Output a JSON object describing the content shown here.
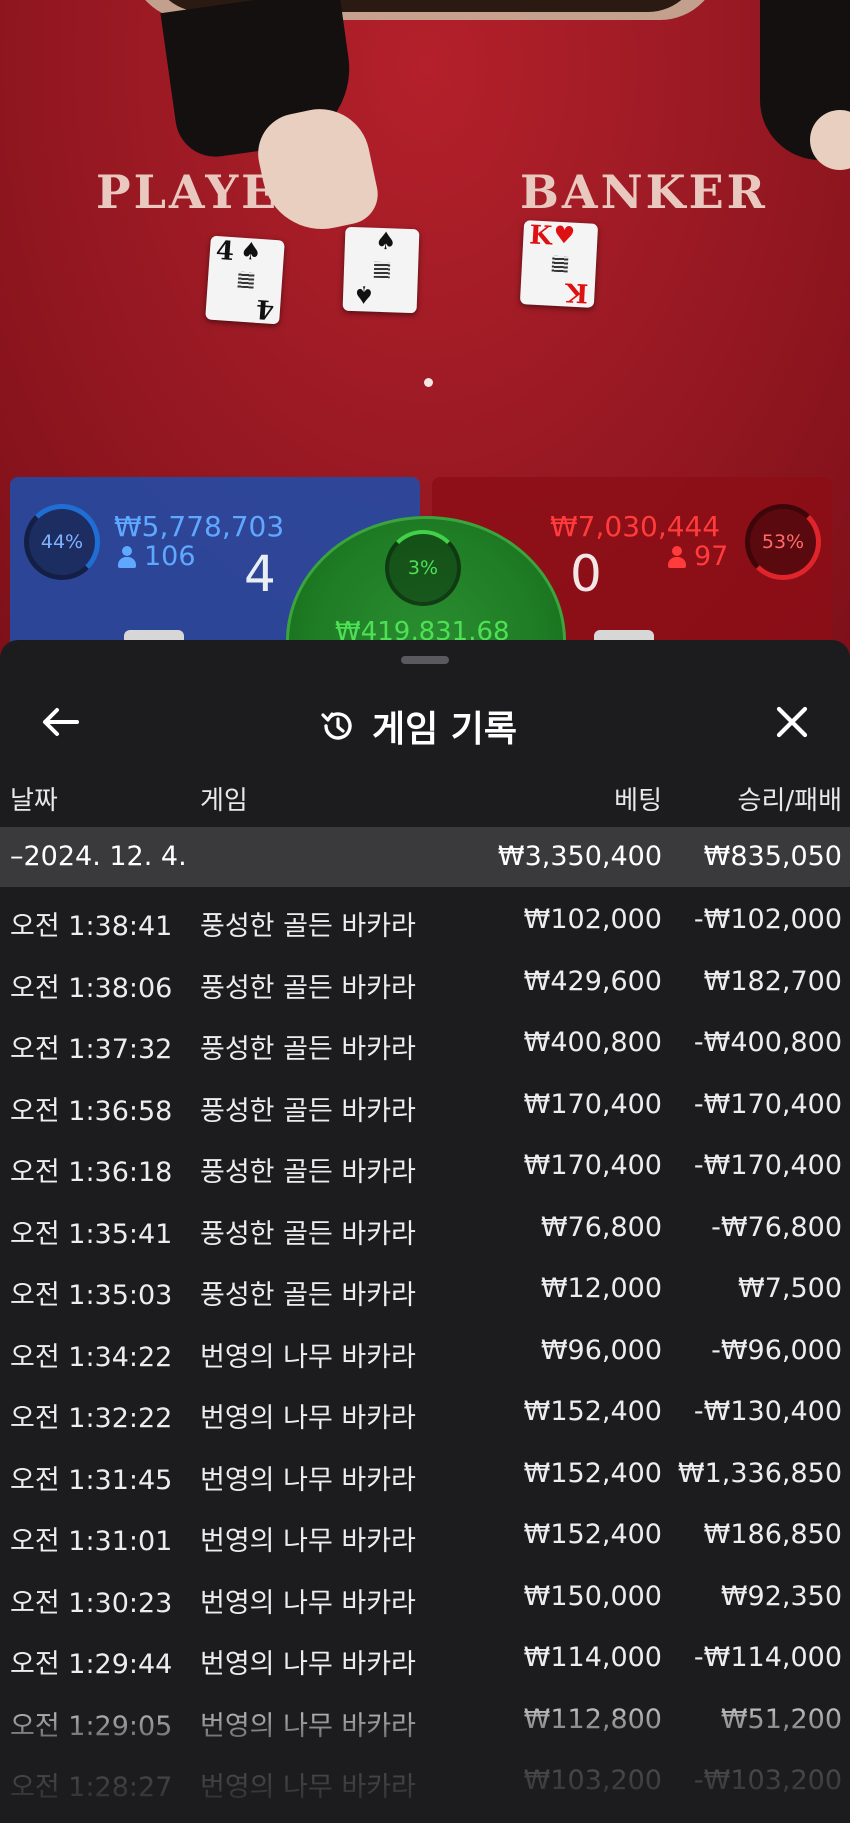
{
  "table": {
    "player_label": "PLAYER",
    "banker_label": "BANKER",
    "cards": [
      {
        "rank": "4",
        "suit": "♠"
      },
      {
        "rank": "?",
        "suit": "♠"
      },
      {
        "rank": "K",
        "suit": "♥"
      }
    ]
  },
  "bets": {
    "player": {
      "percent": "44%",
      "amount": "₩5,778,703",
      "players": "106",
      "score": "4"
    },
    "tie": {
      "percent": "3%",
      "amount": "₩419,831.68"
    },
    "banker": {
      "percent": "53%",
      "amount": "₩7,030,444",
      "players": "97",
      "score": "0"
    }
  },
  "colors": {
    "player": "#1f6ed4",
    "banker": "#e0242c",
    "tie": "#2a8d30",
    "sheet_bg": "#1c1c1e"
  },
  "sheet": {
    "title": "게임 기록",
    "back_icon": "arrow-left-icon",
    "history_icon": "history-icon",
    "close_icon": "close-icon",
    "columns": {
      "date": "날짜",
      "game": "게임",
      "bet": "베팅",
      "result": "승리/패배"
    },
    "group": {
      "date": "–2024. 12. 4.",
      "bet_total": "₩3,350,400",
      "result_total": "₩835,050"
    },
    "rows": [
      {
        "time": "오전 1:38:41",
        "game": "풍성한 골든 바카라",
        "bet": "₩102,000",
        "result": "-₩102,000"
      },
      {
        "time": "오전 1:38:06",
        "game": "풍성한 골든 바카라",
        "bet": "₩429,600",
        "result": "₩182,700"
      },
      {
        "time": "오전 1:37:32",
        "game": "풍성한 골든 바카라",
        "bet": "₩400,800",
        "result": "-₩400,800"
      },
      {
        "time": "오전 1:36:58",
        "game": "풍성한 골든 바카라",
        "bet": "₩170,400",
        "result": "-₩170,400"
      },
      {
        "time": "오전 1:36:18",
        "game": "풍성한 골든 바카라",
        "bet": "₩170,400",
        "result": "-₩170,400"
      },
      {
        "time": "오전 1:35:41",
        "game": "풍성한 골든 바카라",
        "bet": "₩76,800",
        "result": "-₩76,800"
      },
      {
        "time": "오전 1:35:03",
        "game": "풍성한 골든 바카라",
        "bet": "₩12,000",
        "result": "₩7,500"
      },
      {
        "time": "오전 1:34:22",
        "game": "번영의 나무 바카라",
        "bet": "₩96,000",
        "result": "-₩96,000"
      },
      {
        "time": "오전 1:32:22",
        "game": "번영의 나무 바카라",
        "bet": "₩152,400",
        "result": "-₩130,400"
      },
      {
        "time": "오전 1:31:45",
        "game": "번영의 나무 바카라",
        "bet": "₩152,400",
        "result": "₩1,336,850"
      },
      {
        "time": "오전 1:31:01",
        "game": "번영의 나무 바카라",
        "bet": "₩152,400",
        "result": "₩186,850"
      },
      {
        "time": "오전 1:30:23",
        "game": "번영의 나무 바카라",
        "bet": "₩150,000",
        "result": "₩92,350"
      },
      {
        "time": "오전 1:29:44",
        "game": "번영의 나무 바카라",
        "bet": "₩114,000",
        "result": "-₩114,000"
      },
      {
        "time": "오전 1:29:05",
        "game": "번영의 나무 바카라",
        "bet": "₩112,800",
        "result": "₩51,200"
      },
      {
        "time": "오전 1:28:27",
        "game": "번영의 나무 바카라",
        "bet": "₩103,200",
        "result": "-₩103,200"
      }
    ]
  }
}
